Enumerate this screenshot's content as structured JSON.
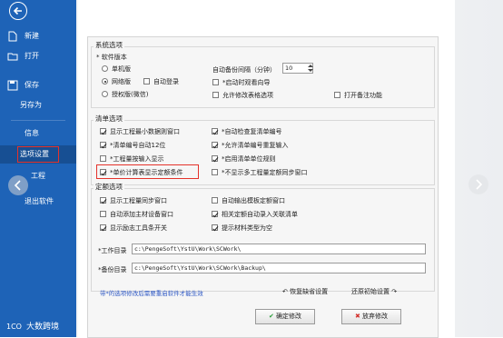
{
  "sidebar": {
    "items": [
      {
        "label": "新建"
      },
      {
        "label": "打开"
      },
      {
        "label": "保存"
      },
      {
        "label": "另存为"
      },
      {
        "label": "信息"
      },
      {
        "label": "选项设置"
      },
      {
        "label": "工程"
      },
      {
        "label": "退出软件"
      }
    ],
    "brand": "大数跨境"
  },
  "sections": {
    "system": "系统选项",
    "bill": "清单选项",
    "quota": "定额选项"
  },
  "system": {
    "version_label": "* 软件版本",
    "radio_standalone": "单机版",
    "radio_network": "网络版",
    "auto_login": "自动登录",
    "radio_auth": "授权版(微信)",
    "backup_interval_label": "自动备份间隔（分钟）",
    "backup_interval_value": "10",
    "startup_wizard": "*启动时观看向导",
    "allow_select_option": "允许修改表格选项",
    "print_remark": "打开备注功能"
  },
  "bill": {
    "items": [
      "显示工程最小数据则窗口",
      "*自动检查复清单编号",
      "*清单编号自动12位",
      "*允许清单编号重复输入",
      "*工程量按输入显示",
      "*启用清单单位规则",
      "*单价计算表显示定额条件",
      "*不显示多工程量定额同步窗口"
    ]
  },
  "quota": {
    "items": [
      "显示工程量同步窗口",
      "自动输出模板定额窗口",
      "自动添加主材设备窗口",
      "相关定额自动录入关联清单",
      "显示励志工具条开关",
      "提示材料类型为空"
    ],
    "workdir_label": "*工作目录",
    "workdir_value": "c:\\PengeSoft\\YstU\\Work\\SCWork\\",
    "backupdir_label": "*备份目录",
    "backupdir_value": "c:\\PengeSoft\\YstU\\Work\\SCWork\\Backup\\"
  },
  "footer": {
    "note": "带*的选项修改后需要重启软件才能生效",
    "restore_default": "恢复缺省设置",
    "restore_initial": "还原初始设置",
    "confirm": "确定修改",
    "cancel": "放弃修改"
  }
}
